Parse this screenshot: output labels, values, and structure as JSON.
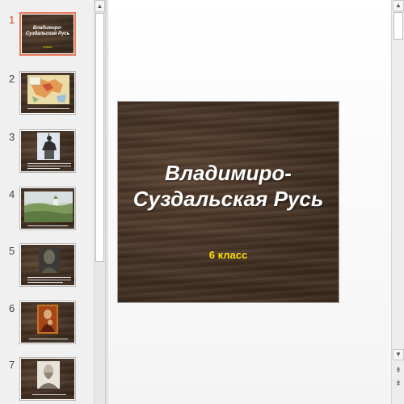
{
  "thumbnails": [
    {
      "number": "1",
      "title": "Владимиро-Суздальская Русь",
      "subtitle": "6 класс",
      "selected": true
    },
    {
      "number": "2",
      "image": "map-image"
    },
    {
      "number": "3",
      "image": "monument-image"
    },
    {
      "number": "4",
      "image": "landscape-painting-image"
    },
    {
      "number": "5",
      "image": "bust-image"
    },
    {
      "number": "6",
      "image": "icon-painting-image"
    },
    {
      "number": "7",
      "image": "portrait-drawing-image"
    }
  ],
  "main_slide": {
    "title_line1": "Владимиро-",
    "title_line2": "Суздальская Русь",
    "subtitle": "6 класс"
  },
  "scroll": {
    "up_arrow": "▲",
    "down_arrow": "▼",
    "prev_slide": "⇞",
    "next_slide": "⇟"
  },
  "colors": {
    "selection_accent": "#e8785a",
    "slide_title": "#ffffff",
    "slide_subtitle": "#ffe000",
    "slide_background": "#4a3524"
  }
}
